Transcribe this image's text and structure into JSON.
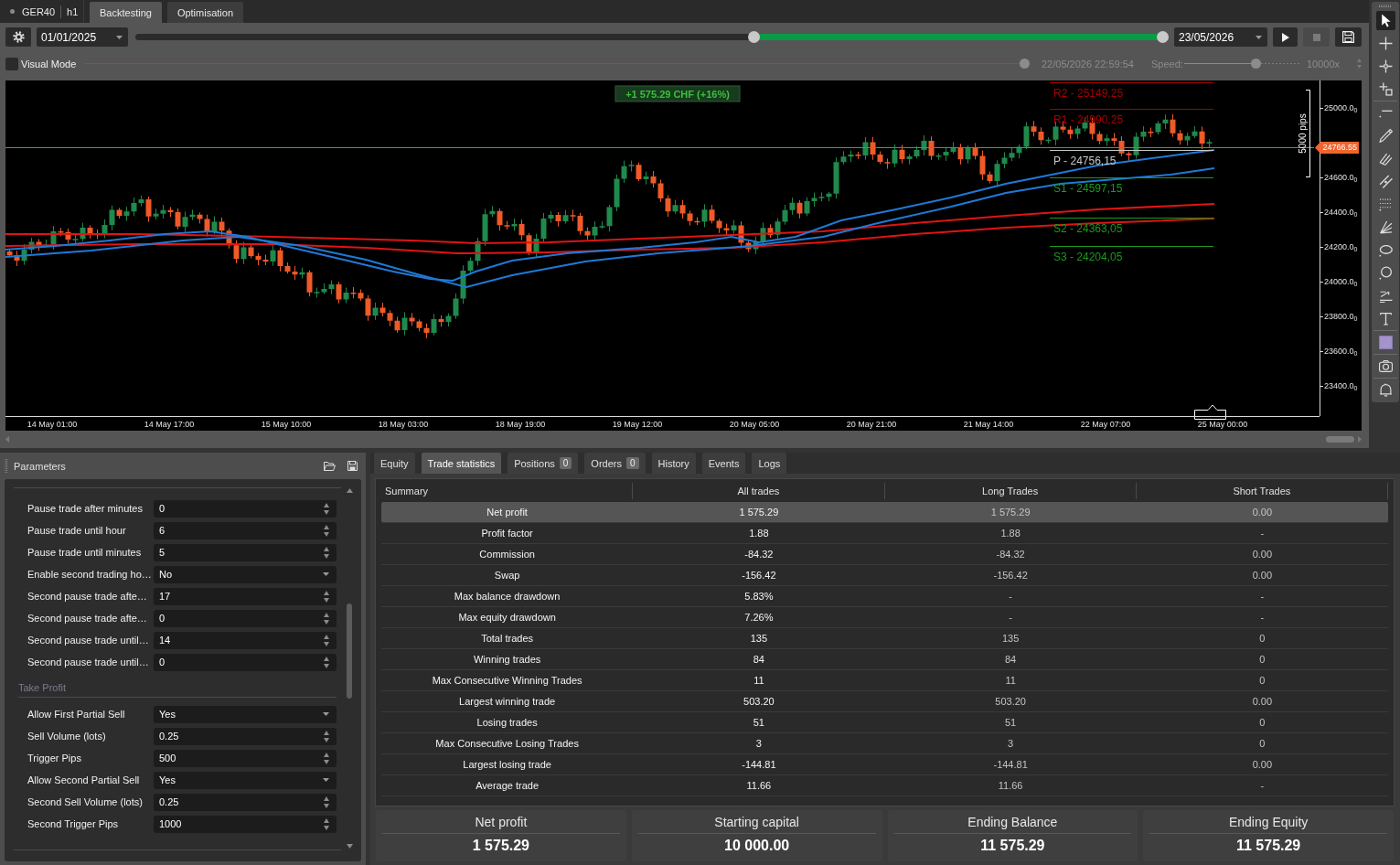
{
  "symbol_tab": {
    "symbol": "GER40",
    "timeframe": "h1"
  },
  "tabs": [
    {
      "label": "Backtesting",
      "selected": true
    },
    {
      "label": "Optimisation",
      "selected": false
    }
  ],
  "backtest": {
    "start_date": "01/01/2025",
    "period": {
      "start": {
        "level": 0.6
      },
      "end": {
        "level": 1.0
      }
    },
    "end_date": "23/05/2026",
    "buttons": [
      {
        "kind": "play",
        "disabled": false
      },
      {
        "kind": "stop",
        "disabled": true
      },
      {
        "kind": "save",
        "disabled": false
      }
    ],
    "visual_mode": {
      "label": "Visual Mode",
      "checked": false
    },
    "playback": {
      "disabled": true,
      "progress": {
        "level": 1.0
      },
      "time": "22/05/2026 22:59:54",
      "speed_label": "Speed:",
      "speed": {
        "level": 0.62
      },
      "speed_value": "10000x"
    }
  },
  "chart": {
    "profit_label": "+1 575.29 CHF (+16%)",
    "pivots": [
      {
        "label": "R2 - 25149,25",
        "color": "#a80000"
      },
      {
        "label": "R1 - 24990,25",
        "color": "#a80000"
      },
      {
        "label": "P - 24756,15",
        "color": "#c8c8c8"
      },
      {
        "label": "S1 - 24597,15",
        "color": "#1c9a1c"
      },
      {
        "label": "S2 - 24363,05",
        "color": "#1c9a1c"
      },
      {
        "label": "S3 - 24204,05",
        "color": "#1c9a1c"
      }
    ],
    "ruler_label": "5000 pips",
    "current_price": "24766.55",
    "price_ticks": [
      "25000.0$_{0}$",
      "24600.0$_{0}$",
      "24400.0$_{0}$",
      "24200.0$_{0}$",
      "24000.0$_{0}$",
      "23800.0$_{0}$",
      "23600.0$_{0}$",
      "23400.0$_{0}$"
    ],
    "time_ticks": [
      "14 May 01:00",
      "14 May 17:00",
      "15 May 10:00",
      "18 May 03:00",
      "18 May 19:00",
      "19 May 12:00",
      "20 May 05:00",
      "20 May 21:00",
      "21 May 14:00",
      "22 May 07:00",
      "25 May 00:00"
    ]
  },
  "toolbar": {
    "groups": [
      {
        "tools": [
          {
            "kind": "pointer",
            "selected": true
          },
          {
            "kind": "crosshair",
            "selected": false
          },
          {
            "kind": "measure",
            "selected": false
          },
          {
            "kind": "zoom",
            "selected": false
          }
        ]
      },
      {
        "tools": [
          {
            "kind": "hline",
            "selected": false
          },
          {
            "kind": "brush",
            "selected": false
          },
          {
            "kind": "pattern",
            "selected": false
          },
          {
            "kind": "channel",
            "selected": false
          },
          {
            "kind": "grid",
            "selected": false
          },
          {
            "kind": "fan",
            "selected": false
          },
          {
            "kind": "ellipse",
            "selected": false
          },
          {
            "kind": "circle",
            "selected": false
          },
          {
            "kind": "trend",
            "selected": false
          },
          {
            "kind": "text",
            "selected": false
          }
        ]
      },
      {
        "tools": [
          {
            "kind": "swatch",
            "selected": false
          }
        ]
      },
      {
        "tools": [
          {
            "kind": "camera",
            "selected": false
          }
        ]
      },
      {
        "tools": [
          {
            "kind": "alert",
            "selected": false
          }
        ]
      }
    ]
  },
  "parameters": {
    "title": "Parameters",
    "rows": [
      {
        "label": "Pause trade after minutes",
        "value": "0",
        "kind": "number"
      },
      {
        "label": "Pause trade until hour",
        "value": "6",
        "kind": "number"
      },
      {
        "label": "Pause trade until minutes",
        "value": "5",
        "kind": "number"
      },
      {
        "label": "Enable second trading ho…",
        "value": "No",
        "kind": "choice"
      },
      {
        "label": "Second pause trade afte…",
        "value": "17",
        "kind": "number"
      },
      {
        "label": "Second pause trade afte…",
        "value": "0",
        "kind": "number"
      },
      {
        "label": "Second pause trade until…",
        "value": "14",
        "kind": "number"
      },
      {
        "label": "Second pause trade until…",
        "value": "0",
        "kind": "number"
      }
    ],
    "sections": [
      {
        "title": "Take Profit",
        "rows": [
          {
            "label": "Allow First Partial Sell",
            "value": "Yes",
            "kind": "choice"
          },
          {
            "label": "Sell Volume (lots)",
            "value": "0.25",
            "kind": "number"
          },
          {
            "label": "Trigger Pips",
            "value": "500",
            "kind": "number"
          },
          {
            "label": "Allow Second Partial Sell",
            "value": "Yes",
            "kind": "choice"
          },
          {
            "label": "Second Sell Volume (lots)",
            "value": "0.25",
            "kind": "number"
          },
          {
            "label": "Second Trigger Pips",
            "value": "1000",
            "kind": "number"
          }
        ]
      }
    ]
  },
  "results": {
    "tabs": [
      {
        "label": "Equity",
        "selected": false
      },
      {
        "label": "Trade statistics",
        "selected": true
      },
      {
        "label": "Positions",
        "count": "0",
        "selected": false
      },
      {
        "label": "Orders",
        "count": "0",
        "selected": false
      },
      {
        "label": "History",
        "selected": false
      },
      {
        "label": "Events",
        "selected": false
      },
      {
        "label": "Logs",
        "selected": false
      }
    ],
    "table": {
      "columns": [
        "Summary",
        "All trades",
        "Long Trades",
        "Short Trades"
      ],
      "rows": [
        {
          "cells": [
            "Net profit",
            "1 575.29",
            "1 575.29",
            "0.00"
          ],
          "selected": true
        },
        {
          "cells": [
            "Profit factor",
            "1.88",
            "1.88",
            "-"
          ],
          "selected": false
        },
        {
          "cells": [
            "Commission",
            "-84.32",
            "-84.32",
            "0.00"
          ],
          "selected": false
        },
        {
          "cells": [
            "Swap",
            "-156.42",
            "-156.42",
            "0.00"
          ],
          "selected": false
        },
        {
          "cells": [
            "Max balance drawdown",
            "5.83%",
            "-",
            "-"
          ],
          "selected": false
        },
        {
          "cells": [
            "Max equity drawdown",
            "7.26%",
            "-",
            "-"
          ],
          "selected": false
        },
        {
          "cells": [
            "Total trades",
            "135",
            "135",
            "0"
          ],
          "selected": false
        },
        {
          "cells": [
            "Winning trades",
            "84",
            "84",
            "0"
          ],
          "selected": false
        },
        {
          "cells": [
            "Max Consecutive Winning Trades",
            "11",
            "11",
            "0"
          ],
          "selected": false
        },
        {
          "cells": [
            "Largest winning trade",
            "503.20",
            "503.20",
            "0.00"
          ],
          "selected": false
        },
        {
          "cells": [
            "Losing trades",
            "51",
            "51",
            "0"
          ],
          "selected": false
        },
        {
          "cells": [
            "Max Consecutive Losing Trades",
            "3",
            "3",
            "0"
          ],
          "selected": false
        },
        {
          "cells": [
            "Largest losing trade",
            "-144.81",
            "-144.81",
            "0.00"
          ],
          "selected": false
        },
        {
          "cells": [
            "Average trade",
            "11.66",
            "11.66",
            "-"
          ],
          "selected": false
        }
      ]
    },
    "cards": [
      {
        "label": "Net profit",
        "value": "1 575.29"
      },
      {
        "label": "Starting capital",
        "value": "10 000.00"
      },
      {
        "label": "Ending Balance",
        "value": "11 575.29"
      },
      {
        "label": "Ending Equity",
        "value": "11 575.29"
      }
    ]
  }
}
